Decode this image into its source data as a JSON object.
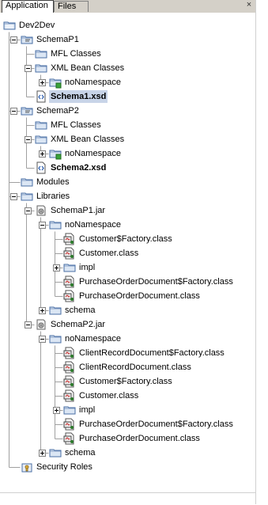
{
  "tabs": [
    "Application",
    "Files"
  ],
  "close_glyph": "×",
  "tree": [
    {
      "label": "Dev2Dev",
      "depth": 0,
      "icon": "workspace-icon",
      "expander": "none"
    },
    {
      "label": "SchemaP1",
      "depth": 1,
      "icon": "project-icon",
      "expander": "minus"
    },
    {
      "label": "MFL Classes",
      "depth": 2,
      "icon": "folder-icon",
      "expander": "none"
    },
    {
      "label": "XML Bean Classes",
      "depth": 2,
      "icon": "folder-icon",
      "expander": "minus"
    },
    {
      "label": "noNamespace",
      "depth": 3,
      "icon": "package-folder-icon",
      "expander": "plus"
    },
    {
      "label": "Schema1.xsd",
      "depth": 2,
      "icon": "xsd-file-icon",
      "expander": "none",
      "selected": true
    },
    {
      "label": "SchemaP2",
      "depth": 1,
      "icon": "project-icon",
      "expander": "minus"
    },
    {
      "label": "MFL Classes",
      "depth": 2,
      "icon": "folder-icon",
      "expander": "none"
    },
    {
      "label": "XML Bean Classes",
      "depth": 2,
      "icon": "folder-icon",
      "expander": "minus"
    },
    {
      "label": "noNamespace",
      "depth": 3,
      "icon": "package-folder-icon",
      "expander": "plus"
    },
    {
      "label": "Schema2.xsd",
      "depth": 2,
      "icon": "xsd-file-icon",
      "expander": "none",
      "bold": true
    },
    {
      "label": "Modules",
      "depth": 1,
      "icon": "folder-icon",
      "expander": "none"
    },
    {
      "label": "Libraries",
      "depth": 1,
      "icon": "folder-icon",
      "expander": "minus"
    },
    {
      "label": "SchemaP1.jar",
      "depth": 2,
      "icon": "jar-icon",
      "expander": "minus"
    },
    {
      "label": "noNamespace",
      "depth": 3,
      "icon": "folder-icon",
      "expander": "minus"
    },
    {
      "label": "Customer$Factory.class",
      "depth": 4,
      "icon": "class-file-icon",
      "expander": "none"
    },
    {
      "label": "Customer.class",
      "depth": 4,
      "icon": "class-file-icon",
      "expander": "none"
    },
    {
      "label": "impl",
      "depth": 4,
      "icon": "folder-icon",
      "expander": "plus"
    },
    {
      "label": "PurchaseOrderDocument$Factory.class",
      "depth": 4,
      "icon": "class-file-icon",
      "expander": "none"
    },
    {
      "label": "PurchaseOrderDocument.class",
      "depth": 4,
      "icon": "class-file-icon",
      "expander": "none"
    },
    {
      "label": "schema",
      "depth": 3,
      "icon": "folder-icon",
      "expander": "plus"
    },
    {
      "label": "SchemaP2.jar",
      "depth": 2,
      "icon": "jar-icon",
      "expander": "minus"
    },
    {
      "label": "noNamespace",
      "depth": 3,
      "icon": "folder-icon",
      "expander": "minus"
    },
    {
      "label": "ClientRecordDocument$Factory.class",
      "depth": 4,
      "icon": "class-file-icon",
      "expander": "none"
    },
    {
      "label": "ClientRecordDocument.class",
      "depth": 4,
      "icon": "class-file-icon",
      "expander": "none"
    },
    {
      "label": "Customer$Factory.class",
      "depth": 4,
      "icon": "class-file-icon",
      "expander": "none"
    },
    {
      "label": "Customer.class",
      "depth": 4,
      "icon": "class-file-icon",
      "expander": "none"
    },
    {
      "label": "impl",
      "depth": 4,
      "icon": "folder-icon",
      "expander": "plus"
    },
    {
      "label": "PurchaseOrderDocument$Factory.class",
      "depth": 4,
      "icon": "class-file-icon",
      "expander": "none"
    },
    {
      "label": "PurchaseOrderDocument.class",
      "depth": 4,
      "icon": "class-file-icon",
      "expander": "none"
    },
    {
      "label": "schema",
      "depth": 3,
      "icon": "folder-icon",
      "expander": "plus"
    },
    {
      "label": "Security Roles",
      "depth": 1,
      "icon": "security-roles-icon",
      "expander": "none"
    }
  ],
  "colors": {
    "selection": "#c8d4e8",
    "folder_fill": "#dbe6f4",
    "folder_stroke": "#4a6fa5",
    "tree_line": "#a0a0a0"
  }
}
